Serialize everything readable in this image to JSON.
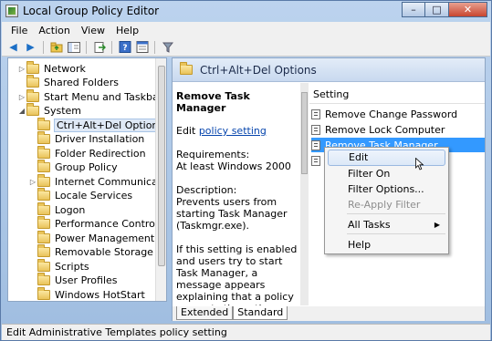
{
  "window": {
    "title": "Local Group Policy Editor",
    "controls": [
      "–",
      "□",
      "✕"
    ]
  },
  "menu": [
    "File",
    "Action",
    "View",
    "Help"
  ],
  "toolbar": {
    "icons": [
      "back-arrow-icon",
      "forward-arrow-icon",
      "up-folder-icon",
      "show-hide-tree-icon",
      "export-list-icon",
      "help-icon",
      "properties-icon",
      "filter-icon"
    ]
  },
  "tree": {
    "items": [
      {
        "label": "Network",
        "indent": 1,
        "expander": "▷"
      },
      {
        "label": "Shared Folders",
        "indent": 1,
        "expander": ""
      },
      {
        "label": "Start Menu and Taskbar",
        "indent": 1,
        "expander": "▷"
      },
      {
        "label": "System",
        "indent": 1,
        "expander": "◢"
      },
      {
        "label": "Ctrl+Alt+Del Options",
        "indent": 2,
        "expander": "",
        "selected": true
      },
      {
        "label": "Driver Installation",
        "indent": 2,
        "expander": ""
      },
      {
        "label": "Folder Redirection",
        "indent": 2,
        "expander": ""
      },
      {
        "label": "Group Policy",
        "indent": 2,
        "expander": ""
      },
      {
        "label": "Internet Communication",
        "indent": 2,
        "expander": "▷"
      },
      {
        "label": "Locale Services",
        "indent": 2,
        "expander": ""
      },
      {
        "label": "Logon",
        "indent": 2,
        "expander": ""
      },
      {
        "label": "Performance Control Pa",
        "indent": 2,
        "expander": ""
      },
      {
        "label": "Power Management",
        "indent": 2,
        "expander": ""
      },
      {
        "label": "Removable Storage Ac",
        "indent": 2,
        "expander": ""
      },
      {
        "label": "Scripts",
        "indent": 2,
        "expander": ""
      },
      {
        "label": "User Profiles",
        "indent": 2,
        "expander": ""
      },
      {
        "label": "Windows HotStart",
        "indent": 2,
        "expander": ""
      }
    ]
  },
  "right_pane": {
    "header": "Ctrl+Alt+Del Options",
    "description": {
      "title": "Remove Task Manager",
      "edit_prefix": "Edit",
      "edit_link": "policy setting",
      "requirements_label": "Requirements:",
      "requirements_value": "At least Windows 2000",
      "description_label": "Description:",
      "description_text": "Prevents users from starting Task Manager (Taskmgr.exe).",
      "extra_text": "If this setting is enabled and users try to start Task Manager, a message appears explaining that a policy prevents the action."
    },
    "list": {
      "column_header": "Setting",
      "settings": [
        "Remove Change Password",
        "Remove Lock Computer",
        "Remove Task Manager",
        ""
      ],
      "highlighted_index": 2
    },
    "tabs": [
      "Extended",
      "Standard"
    ]
  },
  "context_menu": {
    "items": [
      {
        "label": "Edit",
        "hover": true
      },
      {
        "label": "Filter On"
      },
      {
        "label": "Filter Options..."
      },
      {
        "label": "Re-Apply Filter",
        "disabled": true
      },
      {
        "label": "All Tasks",
        "submenu": true
      },
      {
        "label": "Help"
      }
    ]
  },
  "statusbar": {
    "text": "Edit Administrative Templates policy setting"
  }
}
